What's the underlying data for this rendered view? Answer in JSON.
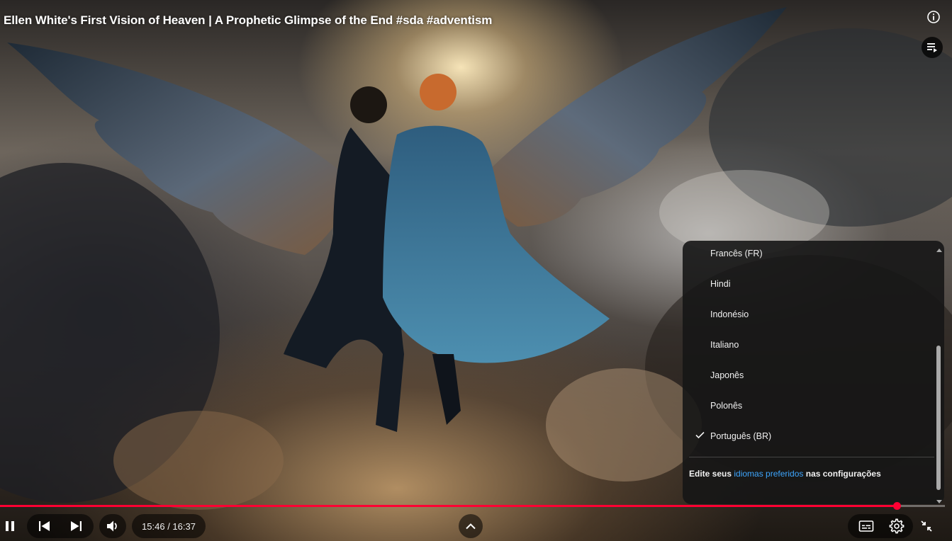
{
  "video": {
    "title": "Ellen White's First Vision of Heaven | A Prophetic Glimpse of the End #sda #adventism"
  },
  "top_controls": {
    "info_icon": "info-circle-icon",
    "playlist_icon": "playlist-icon"
  },
  "settings_menu": {
    "items": [
      {
        "label": "Francês (FR)",
        "selected": false
      },
      {
        "label": "Hindi",
        "selected": false
      },
      {
        "label": "Indonésio",
        "selected": false
      },
      {
        "label": "Italiano",
        "selected": false
      },
      {
        "label": "Japonês",
        "selected": false
      },
      {
        "label": "Polonês",
        "selected": false
      },
      {
        "label": "Português (BR)",
        "selected": true
      }
    ],
    "footer": {
      "prefix": "Edite seus ",
      "link": "idiomas preferidos",
      "suffix": " nas configurações"
    },
    "link_color": "#3ea6ff"
  },
  "player": {
    "current_time": "15:46",
    "duration": "16:37",
    "time_display": "15:46 / 16:37",
    "progress_fraction": 0.949,
    "accent_color": "#ff0033"
  },
  "icons": {
    "pause": "pause-icon",
    "previous": "skip-previous-icon",
    "next": "skip-next-icon",
    "volume": "volume-icon",
    "expand": "chevron-up-icon",
    "captions": "subtitles-icon",
    "settings": "gear-icon",
    "exit_fullscreen": "exit-fullscreen-icon"
  }
}
